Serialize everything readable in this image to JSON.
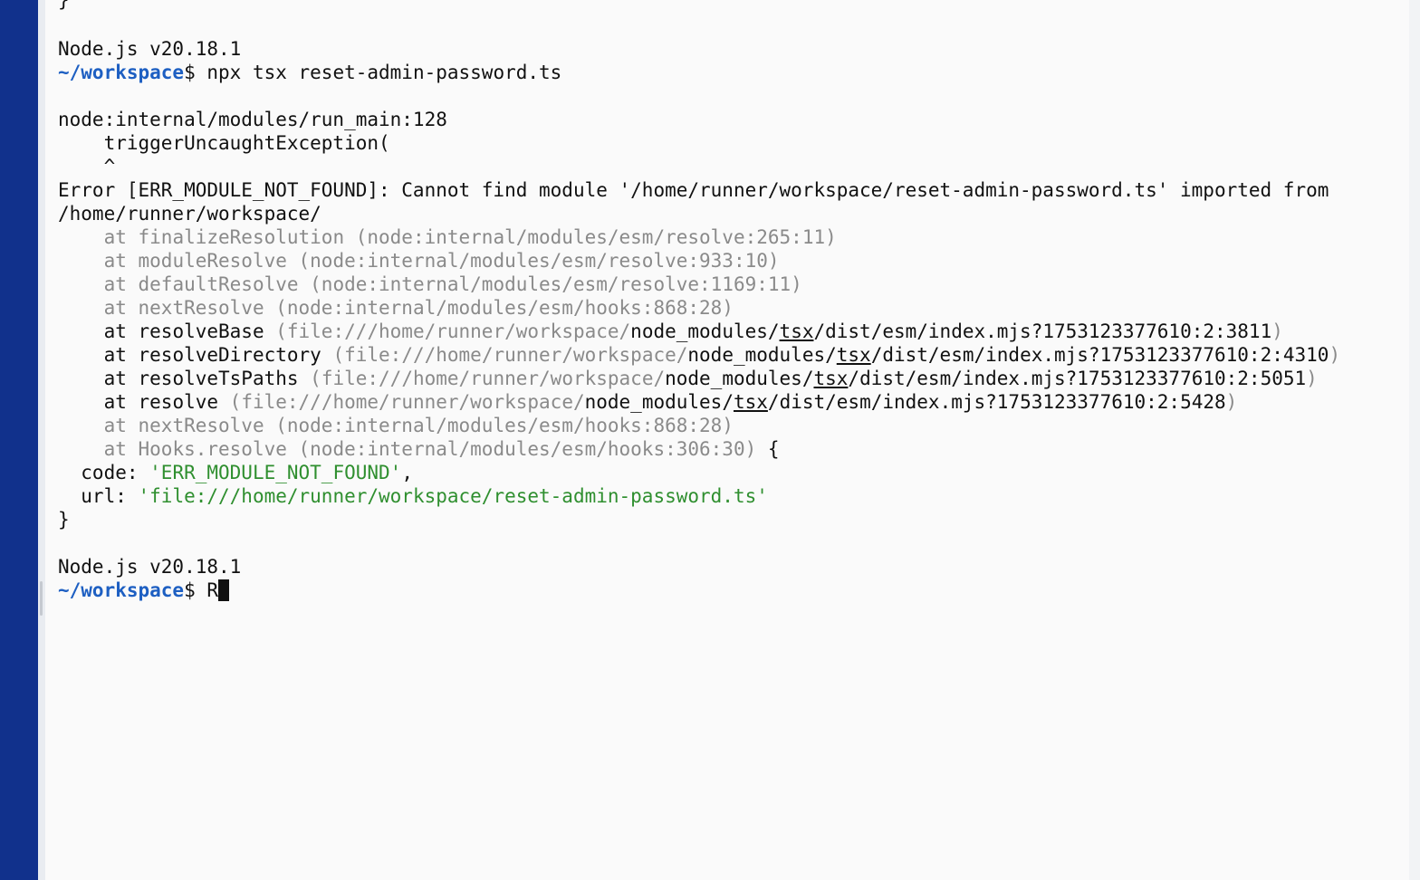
{
  "prev_close_brace": "}",
  "node_version_1": "Node.js v20.18.1",
  "prompt_dir": "~/workspace",
  "prompt_sym": "$ ",
  "command_1": "npx tsx reset-admin-password.ts",
  "trace_loc": "node:internal/modules/run_main:128",
  "trace_code": "    triggerUncaughtException(",
  "trace_caret": "    ^",
  "error_line1": "Error [ERR_MODULE_NOT_FOUND]: Cannot find module '/home/runner/workspace/reset-admin-password.ts' imported from",
  "error_line2": "/home/runner/workspace/",
  "stack_indent": "    ",
  "at": "at ",
  "frames": {
    "f1": "finalizeResolution (node:internal/modules/esm/resolve:265:11)",
    "f2": "moduleResolve (node:internal/modules/esm/resolve:933:10)",
    "f3": "defaultResolve (node:internal/modules/esm/resolve:1169:11)",
    "f4": "nextResolve (node:internal/modules/esm/hooks:868:28)",
    "f5_fn": "resolveBase",
    "f5_loc": "3811",
    "f6_fn": "resolveDirectory",
    "f6_loc": "4310",
    "f7_fn": "resolveTsPaths",
    "f7_loc": "5051",
    "f8_fn": "resolve",
    "f8_loc": "5428",
    "f9": "nextResolve (node:internal/modules/esm/hooks:868:28)",
    "f10": "Hooks.resolve (node:internal/modules/esm/hooks:306:30)"
  },
  "file_prefix": " (file:///home/runner/workspace/",
  "node_modules": "node_modules/",
  "tsx": "tsx",
  "dist_path": "/dist/esm/index.mjs?1753123377610:2:",
  "close_paren": ")",
  "open_brace": " {",
  "code_key": "  code: ",
  "code_val": "'ERR_MODULE_NOT_FOUND'",
  "comma": ",",
  "url_key": "  url: ",
  "url_val": "'file:///home/runner/workspace/reset-admin-password.ts'",
  "close_brace": "}",
  "node_version_2": "Node.js v20.18.1",
  "current_input": "R"
}
